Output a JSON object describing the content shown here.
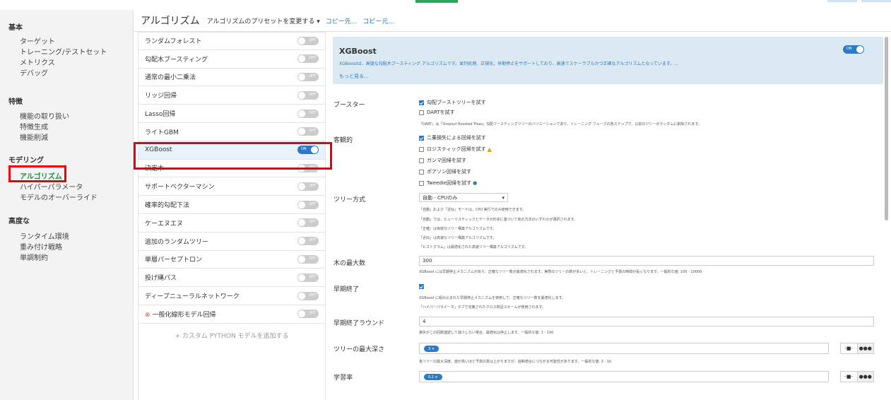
{
  "sidebar": {
    "sections": [
      {
        "label": "基本",
        "items": [
          "ターゲット",
          "トレーニング/テストセット",
          "メトリクス",
          "デバッグ"
        ]
      },
      {
        "label": "特徴",
        "items": [
          "機能の取り扱い",
          "特徴生成",
          "機能削減"
        ]
      },
      {
        "label": "モデリング",
        "items": [
          "アルゴリズム",
          "ハイパーパラメータ",
          "モデルのオーバーライド"
        ]
      },
      {
        "label": "高度な",
        "items": [
          "ランタイム環境",
          "重み付け戦略",
          "単調制約"
        ]
      }
    ]
  },
  "header": {
    "title": "アルゴリズム",
    "preset": "アルゴリズムのプリセットを変更する",
    "copy_to": "コピー先...",
    "copy_from": "コピー元..."
  },
  "toggle": {
    "off": "OFF",
    "on": "ON"
  },
  "algorithms": [
    {
      "name": "ランダムフォレスト",
      "on": false
    },
    {
      "name": "勾配木ブースティング",
      "on": false
    },
    {
      "name": "通常の最小二乗法",
      "on": false
    },
    {
      "name": "リッジ回帰",
      "on": false
    },
    {
      "name": "Lasso回帰",
      "on": false
    },
    {
      "name": "ライトGBM",
      "on": false
    },
    {
      "name": "XGBoost",
      "on": true
    },
    {
      "name": "決定木",
      "on": false
    },
    {
      "name": "サポートベクターマシン",
      "on": false
    },
    {
      "name": "確率的勾配下法",
      "on": false
    },
    {
      "name": "ケーエヌエヌ",
      "on": false
    },
    {
      "name": "追加のランダムツリー",
      "on": false
    },
    {
      "name": "単層パーセプトロン",
      "on": false
    },
    {
      "name": "投げ縄パス",
      "on": false
    },
    {
      "name": "ディープニューラルネットワーク",
      "on": false
    },
    {
      "name": "一般化線形モデル回帰",
      "on": false
    }
  ],
  "add_custom": "+ カスタム PYTHON モデルを追加する",
  "info": {
    "title": "XGBoost",
    "description": "XGBoostは、高度な勾配木ブースティング アルゴリズムです。並列処理、正規化、早期停止をサポートしており、高速でスケーラブルかつ正確なアルゴリズムとなっています。...",
    "more": "もっと見る..."
  },
  "booster": {
    "label": "ブースター",
    "options": [
      {
        "text": "勾配ブーストツリーを試す",
        "checked": true
      },
      {
        "text": "DARTを試す",
        "checked": false
      }
    ],
    "hint": "「DART」は「Dropout Boosted Trees」勾配ブースティングツリーのバリエーションであり、トレーニング フェーズの各ステップで、以前のツリーがランダムに削除されます。"
  },
  "objective": {
    "label": "客観的",
    "options": [
      {
        "text": "二乗損失による回帰を試す",
        "checked": true
      },
      {
        "text": "ロジスティック回帰を試す",
        "checked": false
      },
      {
        "text": "ガンマ回帰を試す",
        "checked": false
      },
      {
        "text": "ポアソン回帰を試す",
        "checked": false
      },
      {
        "text": "Tweedie回帰を試す",
        "checked": false
      }
    ]
  },
  "tree_method": {
    "label": "ツリー方式",
    "value": "自動 - CPUのみ",
    "hints": [
      "「自動」および「近似」モードは、CPU 実行でのみ使用できます。",
      "「自動」では、ヒューリスティックとデータの形状に基づいて他の方法のいずれかが選択されます。",
      "「正確」は貪欲なツリー構築アルゴリズムです。",
      "「近似」は高速なツリー構築アルゴリズムです。",
      "「ヒストグラム」は最適化された高速ツリー構築アルゴリズムです。"
    ]
  },
  "max_trees": {
    "label": "木の最大数",
    "value": "300",
    "hint": "XGBoost には早期停止メカニズムがあり、正確なツリー数が最適化されます。実際のツリーの数が多いと、トレーニングと予測の時間が長くなります。一般的な値: 100 - 10000"
  },
  "early_stop": {
    "label": "早期終了",
    "checked": true,
    "hints": [
      "XGBoost に組み込まれた早期停止メカニズムを使用して、正確なツリー数を最適化します。",
      "「ハイパーパラメータ」タブで定義されたクロス検証スキームが使用されます。"
    ]
  },
  "early_rounds": {
    "label": "早期終了ラウンド",
    "value": "4",
    "hint": "損失がこの回数連続して減少しない場合、最適化は停止します。一般的な値: 1 - 100"
  },
  "max_depth": {
    "label": "ツリーの最大深さ",
    "chip": "3 ×",
    "hint": "各ツリーの最大深度。値が高いほど予測の質は上がりますが、過剰適合につながる可能性があります。一般的な値: 3 - 10"
  },
  "lr": {
    "label": "学習率",
    "chip": "0.2 ×"
  },
  "seg": {
    "minus": "-■-",
    "dots": "●●●"
  }
}
